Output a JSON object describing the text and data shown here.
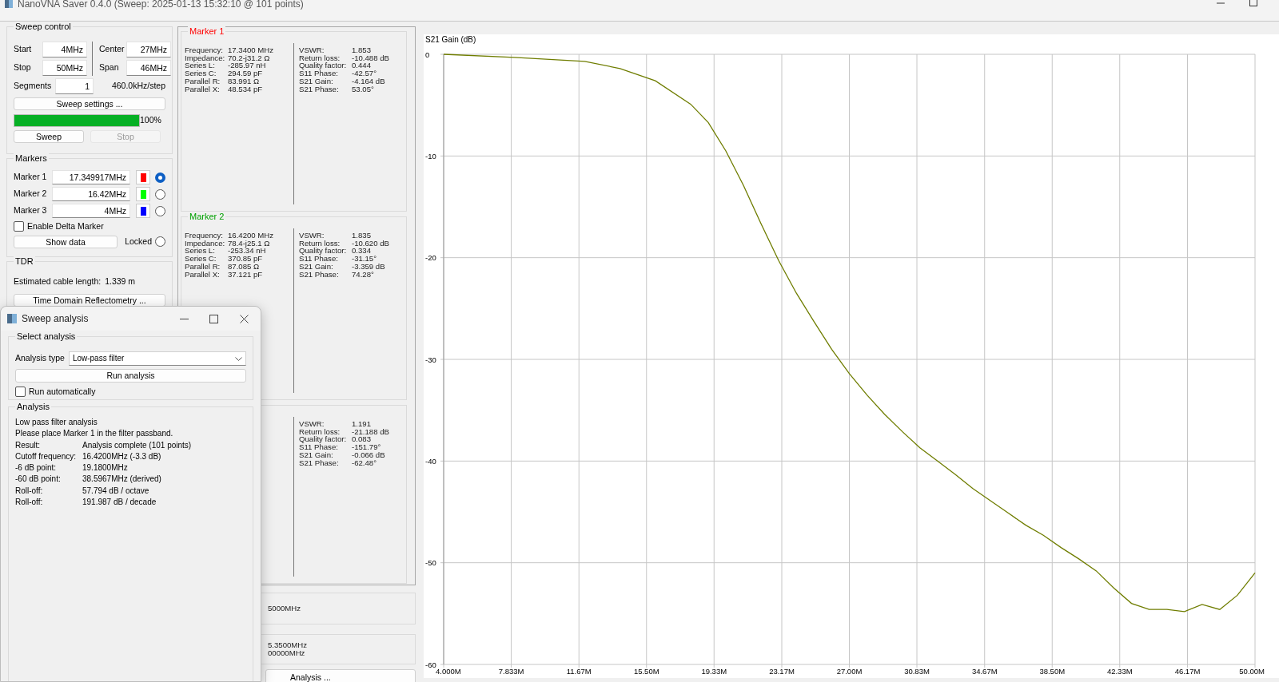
{
  "window": {
    "title": "NanoVNA Saver 0.4.0 (Sweep: 2025-01-13 15:32:10 @ 101 points)"
  },
  "sweep_control": {
    "title": "Sweep control",
    "fields": [
      {
        "label": "Start",
        "value": "4MHz"
      },
      {
        "label": "Center",
        "value": "27MHz"
      },
      {
        "label": "Stop",
        "value": "50MHz"
      },
      {
        "label": "Span",
        "value": "46MHz"
      }
    ],
    "segments": {
      "label": "Segments",
      "value": "1"
    },
    "step": "460.0kHz/step",
    "settings_button": "Sweep settings ...",
    "progress": {
      "level": 1.0,
      "label": "100%"
    },
    "buttons": [
      {
        "label": "Sweep",
        "disabled": false
      },
      {
        "label": "Stop",
        "disabled": true
      }
    ]
  },
  "markers": {
    "title": "Markers",
    "items": [
      {
        "label": "Marker 1",
        "value": "17.349917MHz",
        "color": "#ff0000",
        "selected": true
      },
      {
        "label": "Marker 2",
        "value": "16.42MHz",
        "color": "#00ff00",
        "selected": false
      },
      {
        "label": "Marker 3",
        "value": "4MHz",
        "color": "#0000ff",
        "selected": false
      }
    ],
    "delta": {
      "label": "Enable Delta Marker",
      "checked": false
    },
    "show_data_button": "Show data",
    "locked": {
      "label": "Locked",
      "checked": false
    }
  },
  "tdr": {
    "title": "TDR",
    "cable_length_label": "Estimated cable length:",
    "cable_length": "1.339 m",
    "button": "Time Domain Reflectometry ..."
  },
  "marker_panels": [
    {
      "title": "Marker 1",
      "color": "#ff0000",
      "left": [
        {
          "label": "Frequency:",
          "value": "17.3400 MHz"
        },
        {
          "label": "Impedance:",
          "value": "70.2-j31.2 Ω"
        },
        {
          "label": "Series L:",
          "value": "-285.97 nH"
        },
        {
          "label": "Series C:",
          "value": "294.59 pF"
        },
        {
          "label": "Parallel R:",
          "value": "83.991 Ω"
        },
        {
          "label": "Parallel X:",
          "value": "48.534 pF"
        }
      ],
      "right": [
        {
          "label": "VSWR:",
          "value": "1.853"
        },
        {
          "label": "Return loss:",
          "value": "-10.488 dB"
        },
        {
          "label": "Quality factor:",
          "value": "0.444"
        },
        {
          "label": "S11 Phase:",
          "value": "-42.57°"
        },
        {
          "label": "S21 Gain:",
          "value": "-4.164 dB"
        },
        {
          "label": "S21 Phase:",
          "value": "53.05°"
        }
      ]
    },
    {
      "title": "Marker 2",
      "color": "#00a000",
      "left": [
        {
          "label": "Frequency:",
          "value": "16.4200 MHz"
        },
        {
          "label": "Impedance:",
          "value": "78.4-j25.1 Ω"
        },
        {
          "label": "Series L:",
          "value": "-253.34 nH"
        },
        {
          "label": "Series C:",
          "value": "370.85 pF"
        },
        {
          "label": "Parallel R:",
          "value": "87.085 Ω"
        },
        {
          "label": "Parallel X:",
          "value": "37.121 pF"
        }
      ],
      "right": [
        {
          "label": "VSWR:",
          "value": "1.835"
        },
        {
          "label": "Return loss:",
          "value": "-10.620 dB"
        },
        {
          "label": "Quality factor:",
          "value": "0.334"
        },
        {
          "label": "S11 Phase:",
          "value": "-31.15°"
        },
        {
          "label": "S21 Gain:",
          "value": "-3.359 dB"
        },
        {
          "label": "S21 Phase:",
          "value": "74.28°"
        }
      ]
    },
    {
      "right": [
        {
          "label": "VSWR:",
          "value": "1.191"
        },
        {
          "label": "Return loss:",
          "value": "-21.188 dB"
        },
        {
          "label": "Quality factor:",
          "value": "0.083"
        },
        {
          "label": "S11 Phase:",
          "value": "-151.79°"
        },
        {
          "label": "S21 Gain:",
          "value": "-0.066 dB"
        },
        {
          "label": "S21 Phase:",
          "value": "-62.48°"
        }
      ]
    }
  ],
  "frequency_boxes": [
    {
      "lines": [
        "5000MHz"
      ]
    },
    {
      "lines": [
        "5.3500MHz",
        "00000MHz"
      ]
    }
  ],
  "analysis_button": "Analysis ...",
  "chart": {
    "chart_data": {
      "type": "line",
      "grid": true,
      "ylabel": "S21 Gain (dB)",
      "x": [
        4,
        8,
        12,
        14,
        16,
        18,
        19,
        20,
        21,
        22,
        23,
        24,
        25,
        26,
        27,
        28,
        29,
        30,
        31,
        32,
        33,
        34,
        35,
        36,
        37,
        38,
        39,
        40,
        41,
        42,
        43,
        44,
        45,
        46,
        47,
        48,
        49,
        50
      ],
      "series": [
        {
          "color": "#6f7d00",
          "values": [
            0,
            -0.3,
            -0.7,
            -1.4,
            -2.6,
            -4.9,
            -6.7,
            -9.5,
            -12.9,
            -16.7,
            -20.3,
            -23.5,
            -26.3,
            -29,
            -31.4,
            -33.5,
            -35.4,
            -37.1,
            -38.7,
            -40,
            -41.3,
            -42.7,
            -43.9,
            -45.1,
            -46.3,
            -47.3,
            -48.5,
            -49.6,
            -50.8,
            -52.5,
            -54,
            -54.6,
            -54.6,
            -54.8,
            -54.1,
            -54.6,
            -53.2,
            -51
          ]
        }
      ],
      "xlim": [
        4,
        50
      ],
      "ylim": [
        -60,
        0
      ],
      "xticks": [
        {
          "value": 4,
          "label": "4.000M"
        },
        {
          "value": 7.833,
          "label": "7.833M"
        },
        {
          "value": 11.67,
          "label": "11.67M"
        },
        {
          "value": 15.5,
          "label": "15.50M"
        },
        {
          "value": 19.33,
          "label": "19.33M"
        },
        {
          "value": 23.17,
          "label": "23.17M"
        },
        {
          "value": 27,
          "label": "27.00M"
        },
        {
          "value": 30.83,
          "label": "30.83M"
        },
        {
          "value": 34.67,
          "label": "34.67M"
        },
        {
          "value": 38.5,
          "label": "38.50M"
        },
        {
          "value": 42.33,
          "label": "42.33M"
        },
        {
          "value": 46.17,
          "label": "46.17M"
        },
        {
          "value": 50,
          "label": "50.00M"
        }
      ],
      "yticks": [
        0,
        -10,
        -20,
        -30,
        -40,
        -50,
        -60
      ]
    }
  },
  "analysis_window": {
    "title": "Sweep analysis",
    "select_group": "Select analysis",
    "type_label": "Analysis type",
    "type_value": "Low-pass filter",
    "run_button": "Run analysis",
    "auto": {
      "label": "Run automatically",
      "checked": false
    },
    "results_group": "Analysis",
    "heading": "Low pass filter analysis",
    "note": "Please place Marker 1 in the filter passband.",
    "results": [
      {
        "label": "Result:",
        "value": "Analysis complete (101 points)"
      },
      {
        "label": "Cutoff frequency:",
        "value": "16.4200MHz (-3.3 dB)"
      },
      {
        "label": "-6 dB point:",
        "value": "19.1800MHz"
      },
      {
        "label": "-60 dB point:",
        "value": "38.5967MHz (derived)"
      },
      {
        "label": "Roll-off:",
        "value": "57.794 dB / octave"
      },
      {
        "label": "Roll-off:",
        "value": "191.987 dB / decade"
      }
    ]
  }
}
